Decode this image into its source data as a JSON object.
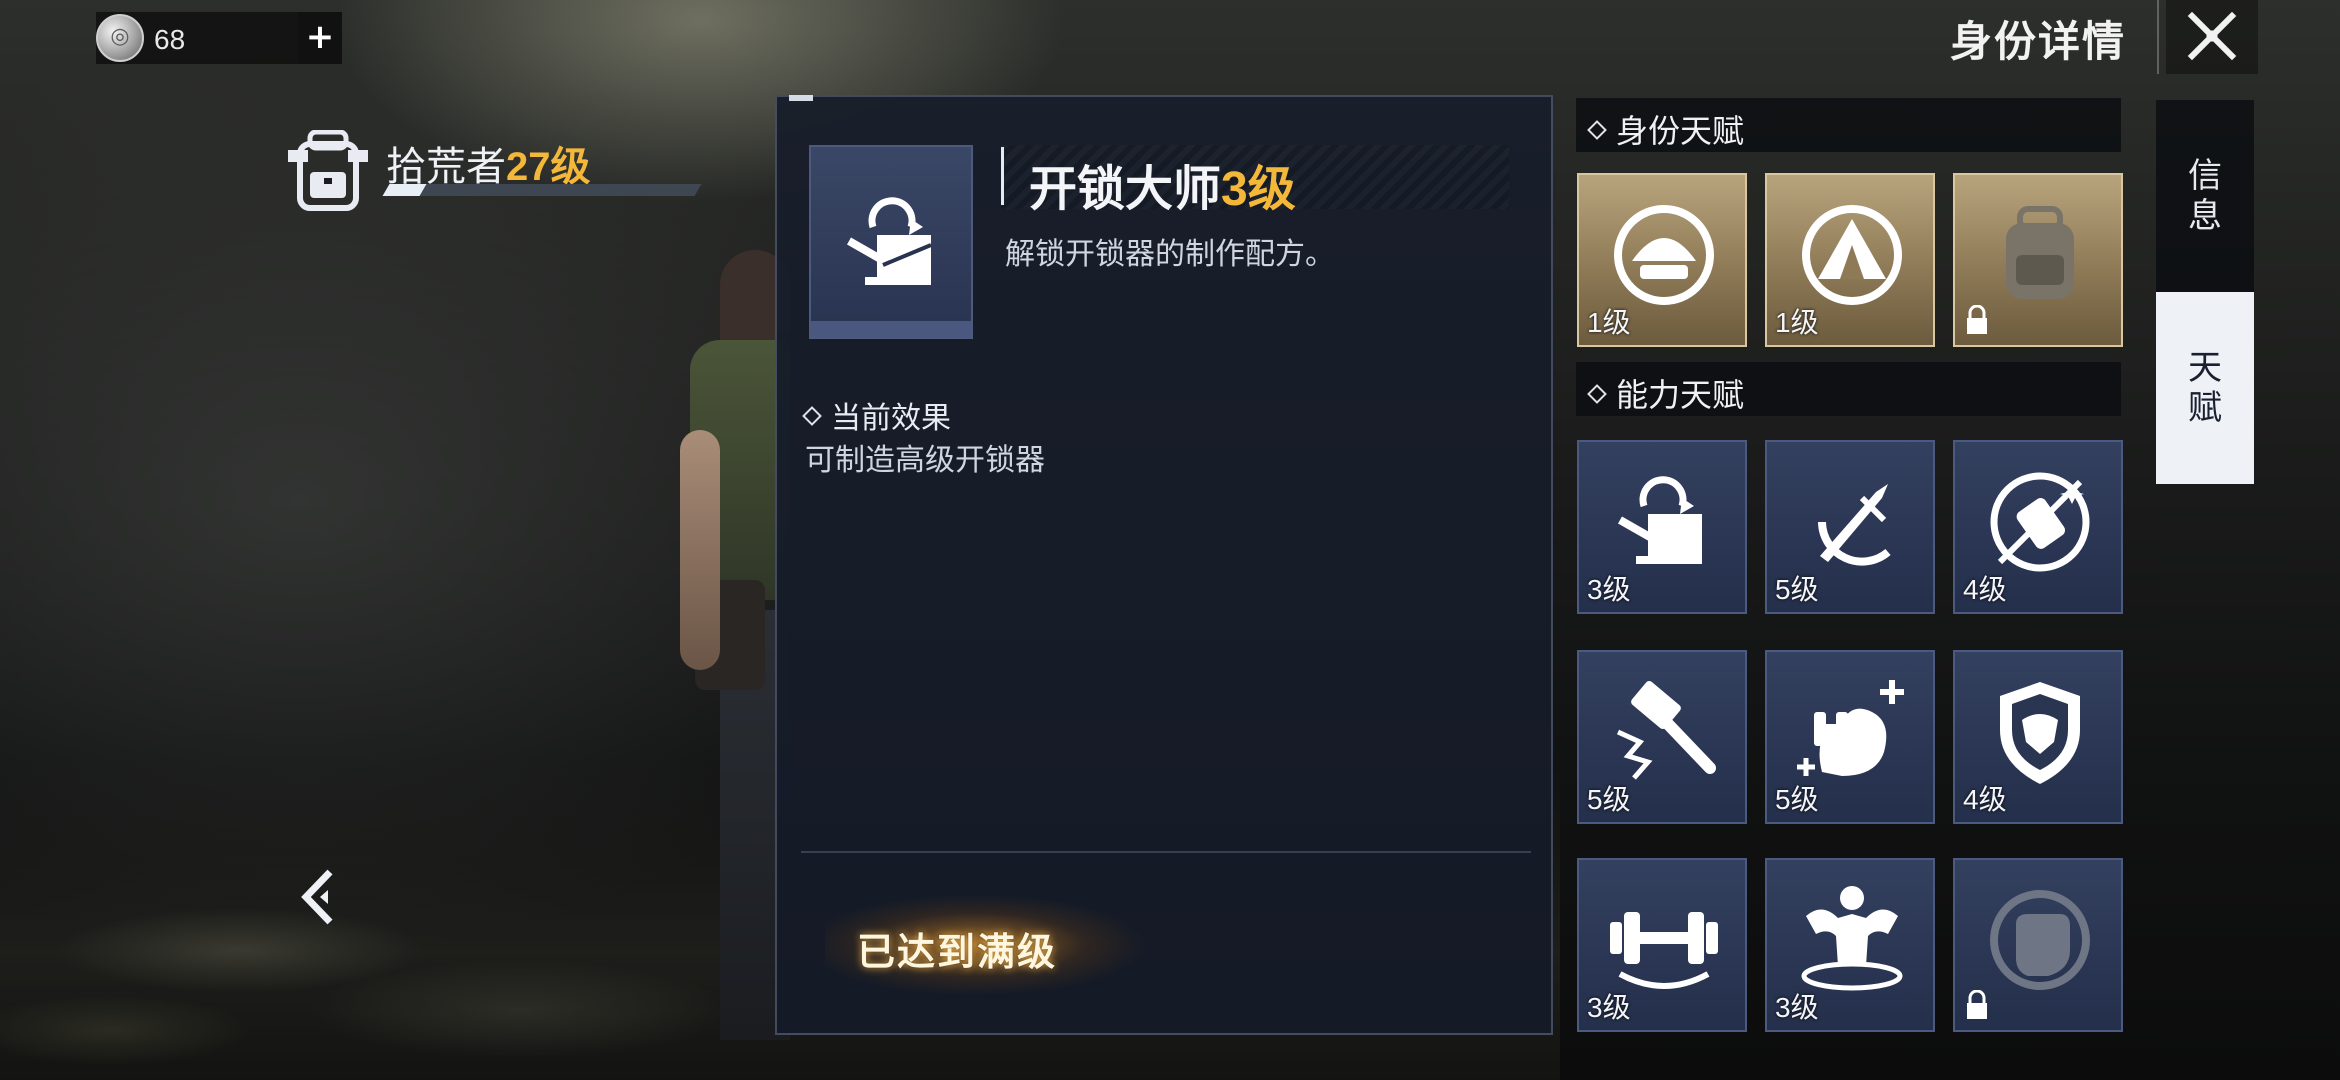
{
  "currency": {
    "amount": "68",
    "add_label": "+"
  },
  "header": {
    "title": "身份详情"
  },
  "identity": {
    "name": "拾荒者",
    "level": "27级",
    "xp_progress": 0.12
  },
  "detail": {
    "skill_name": "开锁大师",
    "skill_level": "3级",
    "description": "解锁开锁器的制作配方。",
    "effect_heading": "当前效果",
    "effect_text": "可制造高级开锁器",
    "max_level_label": "已达到满级"
  },
  "identity_talents": {
    "header": "身份天赋",
    "items": [
      {
        "icon": "helmet-ring-icon",
        "level": "1级",
        "locked": false
      },
      {
        "icon": "tent-ring-icon",
        "level": "1级",
        "locked": false
      },
      {
        "icon": "backpack-icon",
        "level": "",
        "locked": true
      }
    ]
  },
  "ability_talents": {
    "header": "能力天赋",
    "items": [
      {
        "icon": "lockpick-icon",
        "level": "3级",
        "locked": false
      },
      {
        "icon": "knife-icon",
        "level": "5级",
        "locked": false
      },
      {
        "icon": "can-icon",
        "level": "4级",
        "locked": false
      },
      {
        "icon": "hammer-icon",
        "level": "5级",
        "locked": false
      },
      {
        "icon": "muscle-dumbbell-icon",
        "level": "5级",
        "locked": false
      },
      {
        "icon": "shield-icon",
        "level": "4级",
        "locked": false
      },
      {
        "icon": "dumbbell-icon",
        "level": "3级",
        "locked": false
      },
      {
        "icon": "bodybuilder-icon",
        "level": "3级",
        "locked": false
      },
      {
        "icon": "fist-icon",
        "level": "",
        "locked": true
      }
    ]
  },
  "tabs": {
    "info": "信息",
    "talent": "天赋"
  }
}
